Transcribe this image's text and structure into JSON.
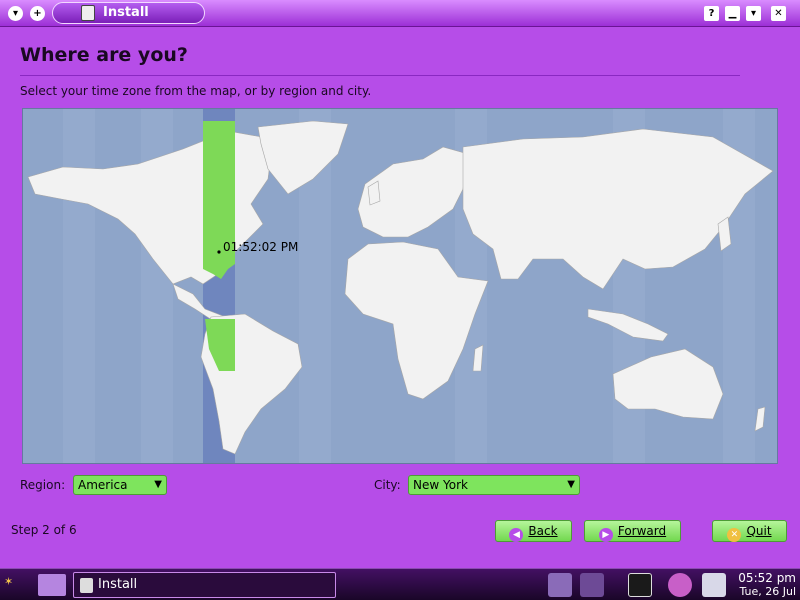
{
  "window": {
    "title": "Install"
  },
  "page": {
    "heading": "Where are you?",
    "subtitle": "Select your time zone from the map, or by region and city.",
    "map_time": "01:52:02 PM"
  },
  "region": {
    "label": "Region:",
    "value": "America"
  },
  "city": {
    "label": "City:",
    "value": "New York"
  },
  "footer": {
    "step": "Step 2 of 6",
    "back_label": "Back",
    "forward_label": "Forward",
    "quit_label": "Quit"
  },
  "taskbar": {
    "task_label": "Install",
    "clock_time": "05:52 pm",
    "clock_date": "Tue, 26 Jul"
  },
  "colors": {
    "window_bg": "#b64de8",
    "accent_green": "#7ee45d",
    "map_ocean": "#8ea5c9",
    "land": "#f2f2f2",
    "selected_zone": "#6f86be"
  }
}
